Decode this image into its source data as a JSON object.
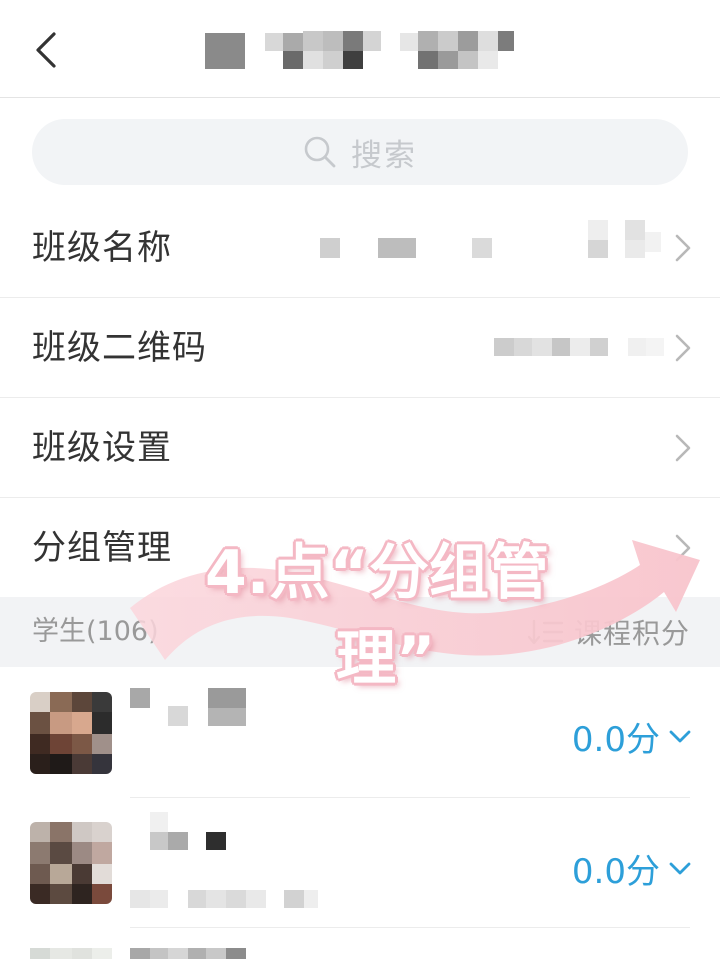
{
  "search": {
    "placeholder": "搜索"
  },
  "menu": [
    {
      "label": "班级名称"
    },
    {
      "label": "班级二维码"
    },
    {
      "label": "班级设置"
    },
    {
      "label": "分组管理"
    }
  ],
  "students_section": {
    "count_label": "学生(106)",
    "sort_label": "课程积分"
  },
  "students": [
    {
      "score": "0.0分"
    },
    {
      "score": "0.0分"
    }
  ],
  "annotation": {
    "line1": "4.点“分组管",
    "line2": "理”"
  },
  "colors": {
    "accent": "#2d9fd9",
    "annotation_pink": "#f4b8c4",
    "arrow_fill": "#fbd6dc"
  },
  "icons": [
    "back-icon",
    "search-icon",
    "chevron-right-icon",
    "sort-icon",
    "chevron-down-icon"
  ]
}
